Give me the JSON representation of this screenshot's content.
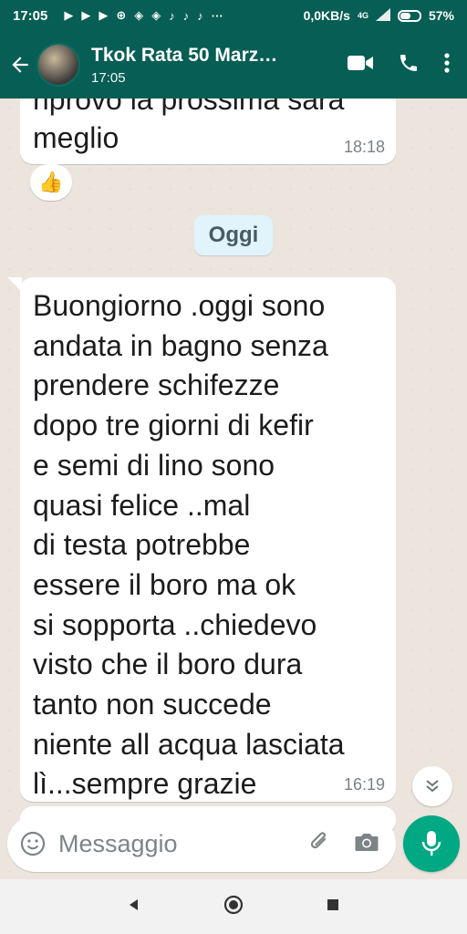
{
  "status_bar": {
    "time": "17:05",
    "network_speed": "0,0KB/s",
    "network_type": "4G",
    "battery_percent": "57%",
    "battery_level": 0.57
  },
  "header": {
    "title": "Tkok Rata 50 Marz…",
    "subtitle": "17:05"
  },
  "messages": [
    {
      "direction": "incoming",
      "partial_text": "riprovo la prossima sarà",
      "text": "meglio",
      "time": "18:18",
      "reaction": "👍"
    }
  ],
  "date_divider": "Oggi",
  "main_message": {
    "lines": [
      "Buongiorno .oggi sono",
      "andata in bagno senza",
      "prendere schifezze",
      "dopo tre giorni di kefir",
      "e semi di lino sono",
      "quasi felice ..mal",
      "di testa potrebbe",
      "essere il boro ma ok",
      "si sopporta ..chiedevo",
      "visto che il boro dura",
      "tanto non succede",
      "niente all acqua lasciata",
      "lì...sempre grazie"
    ],
    "time": "16:19"
  },
  "input": {
    "placeholder": "Messaggio"
  },
  "colors": {
    "header": "#075e54",
    "accent": "#00a884",
    "chat_bg": "#ece5dd",
    "date_chip": "#e1f3fb"
  },
  "icons": [
    "back-arrow-icon",
    "video-call-icon",
    "phone-icon",
    "more-vert-icon",
    "emoji-icon",
    "attach-icon",
    "camera-icon",
    "mic-icon",
    "scroll-down-icon"
  ]
}
